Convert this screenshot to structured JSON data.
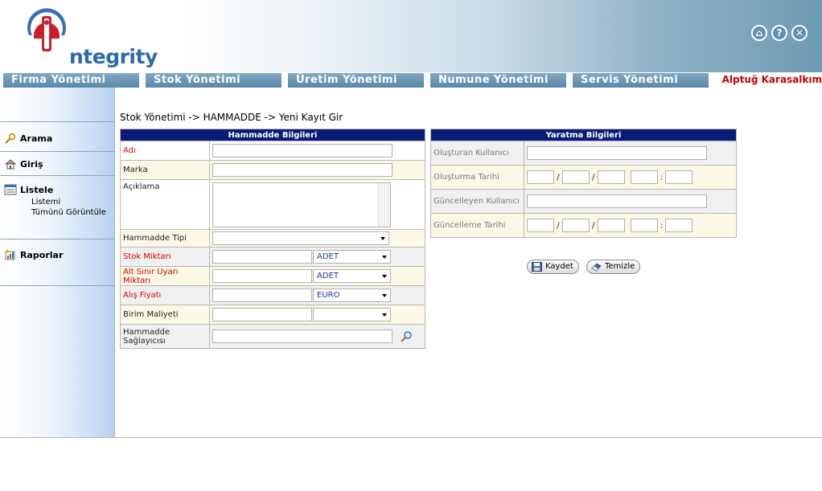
{
  "app": {
    "logo_text": "ntegrity"
  },
  "header_icons": [
    {
      "name": "home-icon",
      "glyph": "⌂"
    },
    {
      "name": "help-icon",
      "glyph": "?"
    },
    {
      "name": "close-icon",
      "glyph": "✕"
    }
  ],
  "nav": {
    "tabs": [
      "Firma Yönetimi",
      "Stok Yönetimi",
      "Üretim Yönetimi",
      "Numune Yönetimi",
      "Servis Yönetimi"
    ],
    "user": "Alptuğ Karasalkım"
  },
  "sidebar": {
    "search": "Arama",
    "entry": "Giriş",
    "list": "Listele",
    "list_sub": [
      "Listemi",
      "Tümünü Görüntüle"
    ],
    "reports": "Raporlar"
  },
  "breadcrumb": "Stok Yönetimi -> HAMMADDE -> Yeni Kayıt Gir",
  "hammadde": {
    "title": "Hammadde Bilgileri",
    "fields": {
      "adi": "Adı",
      "marka": "Marka",
      "aciklama": "Açıklama",
      "tipi": "Hammadde Tipi",
      "stok": "Stok Miktarı",
      "stok_unit": "ADET",
      "alt_sinir": "Alt Sınır Uyarı Miktarı",
      "alt_sinir_unit": "ADET",
      "alis": "Alış Fiyatı",
      "alis_currency": "EURO",
      "birim": "Birim Maliyeti",
      "saglayici": "Hammadde Sağlayıcısı"
    }
  },
  "yaratma": {
    "title": "Yaratma Bilgileri",
    "olusturan": "Oluşturan Kullanıcı",
    "olusturma_tarihi": "Oluşturma Tarihi",
    "guncelleyen": "Güncelleyen Kullanıcı",
    "guncelleme_tarihi": "Güncelleme Tarihi",
    "date_sep": "/",
    "time_sep": ":"
  },
  "buttons": {
    "save": "Kaydet",
    "clear": "Temizle"
  }
}
